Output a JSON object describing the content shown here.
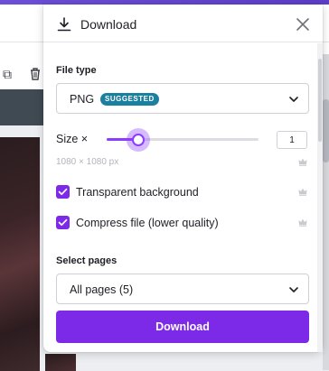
{
  "panel": {
    "title": "Download",
    "file_type": {
      "label": "File type",
      "value": "PNG",
      "badge": "SUGGESTED"
    },
    "size": {
      "label": "Size ×",
      "value": "1",
      "slider_fraction": 0.21,
      "dimensions": "1080 × 1080 px"
    },
    "options": [
      {
        "label": "Transparent background",
        "checked": true
      },
      {
        "label": "Compress file (lower quality)",
        "checked": true
      }
    ],
    "pages": {
      "label": "Select pages",
      "value": "All pages (5)"
    },
    "download_button": "Download"
  },
  "colors": {
    "accent": "#7d2ae8",
    "slider": "#8b3dff",
    "badge": "#1b80a0",
    "crown": "#c9cad0"
  },
  "icons": {
    "header": "download-icon",
    "close": "close-icon",
    "dropdown": "chevron-down-icon",
    "premium": "crown-icon",
    "check": "checkmark-icon"
  }
}
